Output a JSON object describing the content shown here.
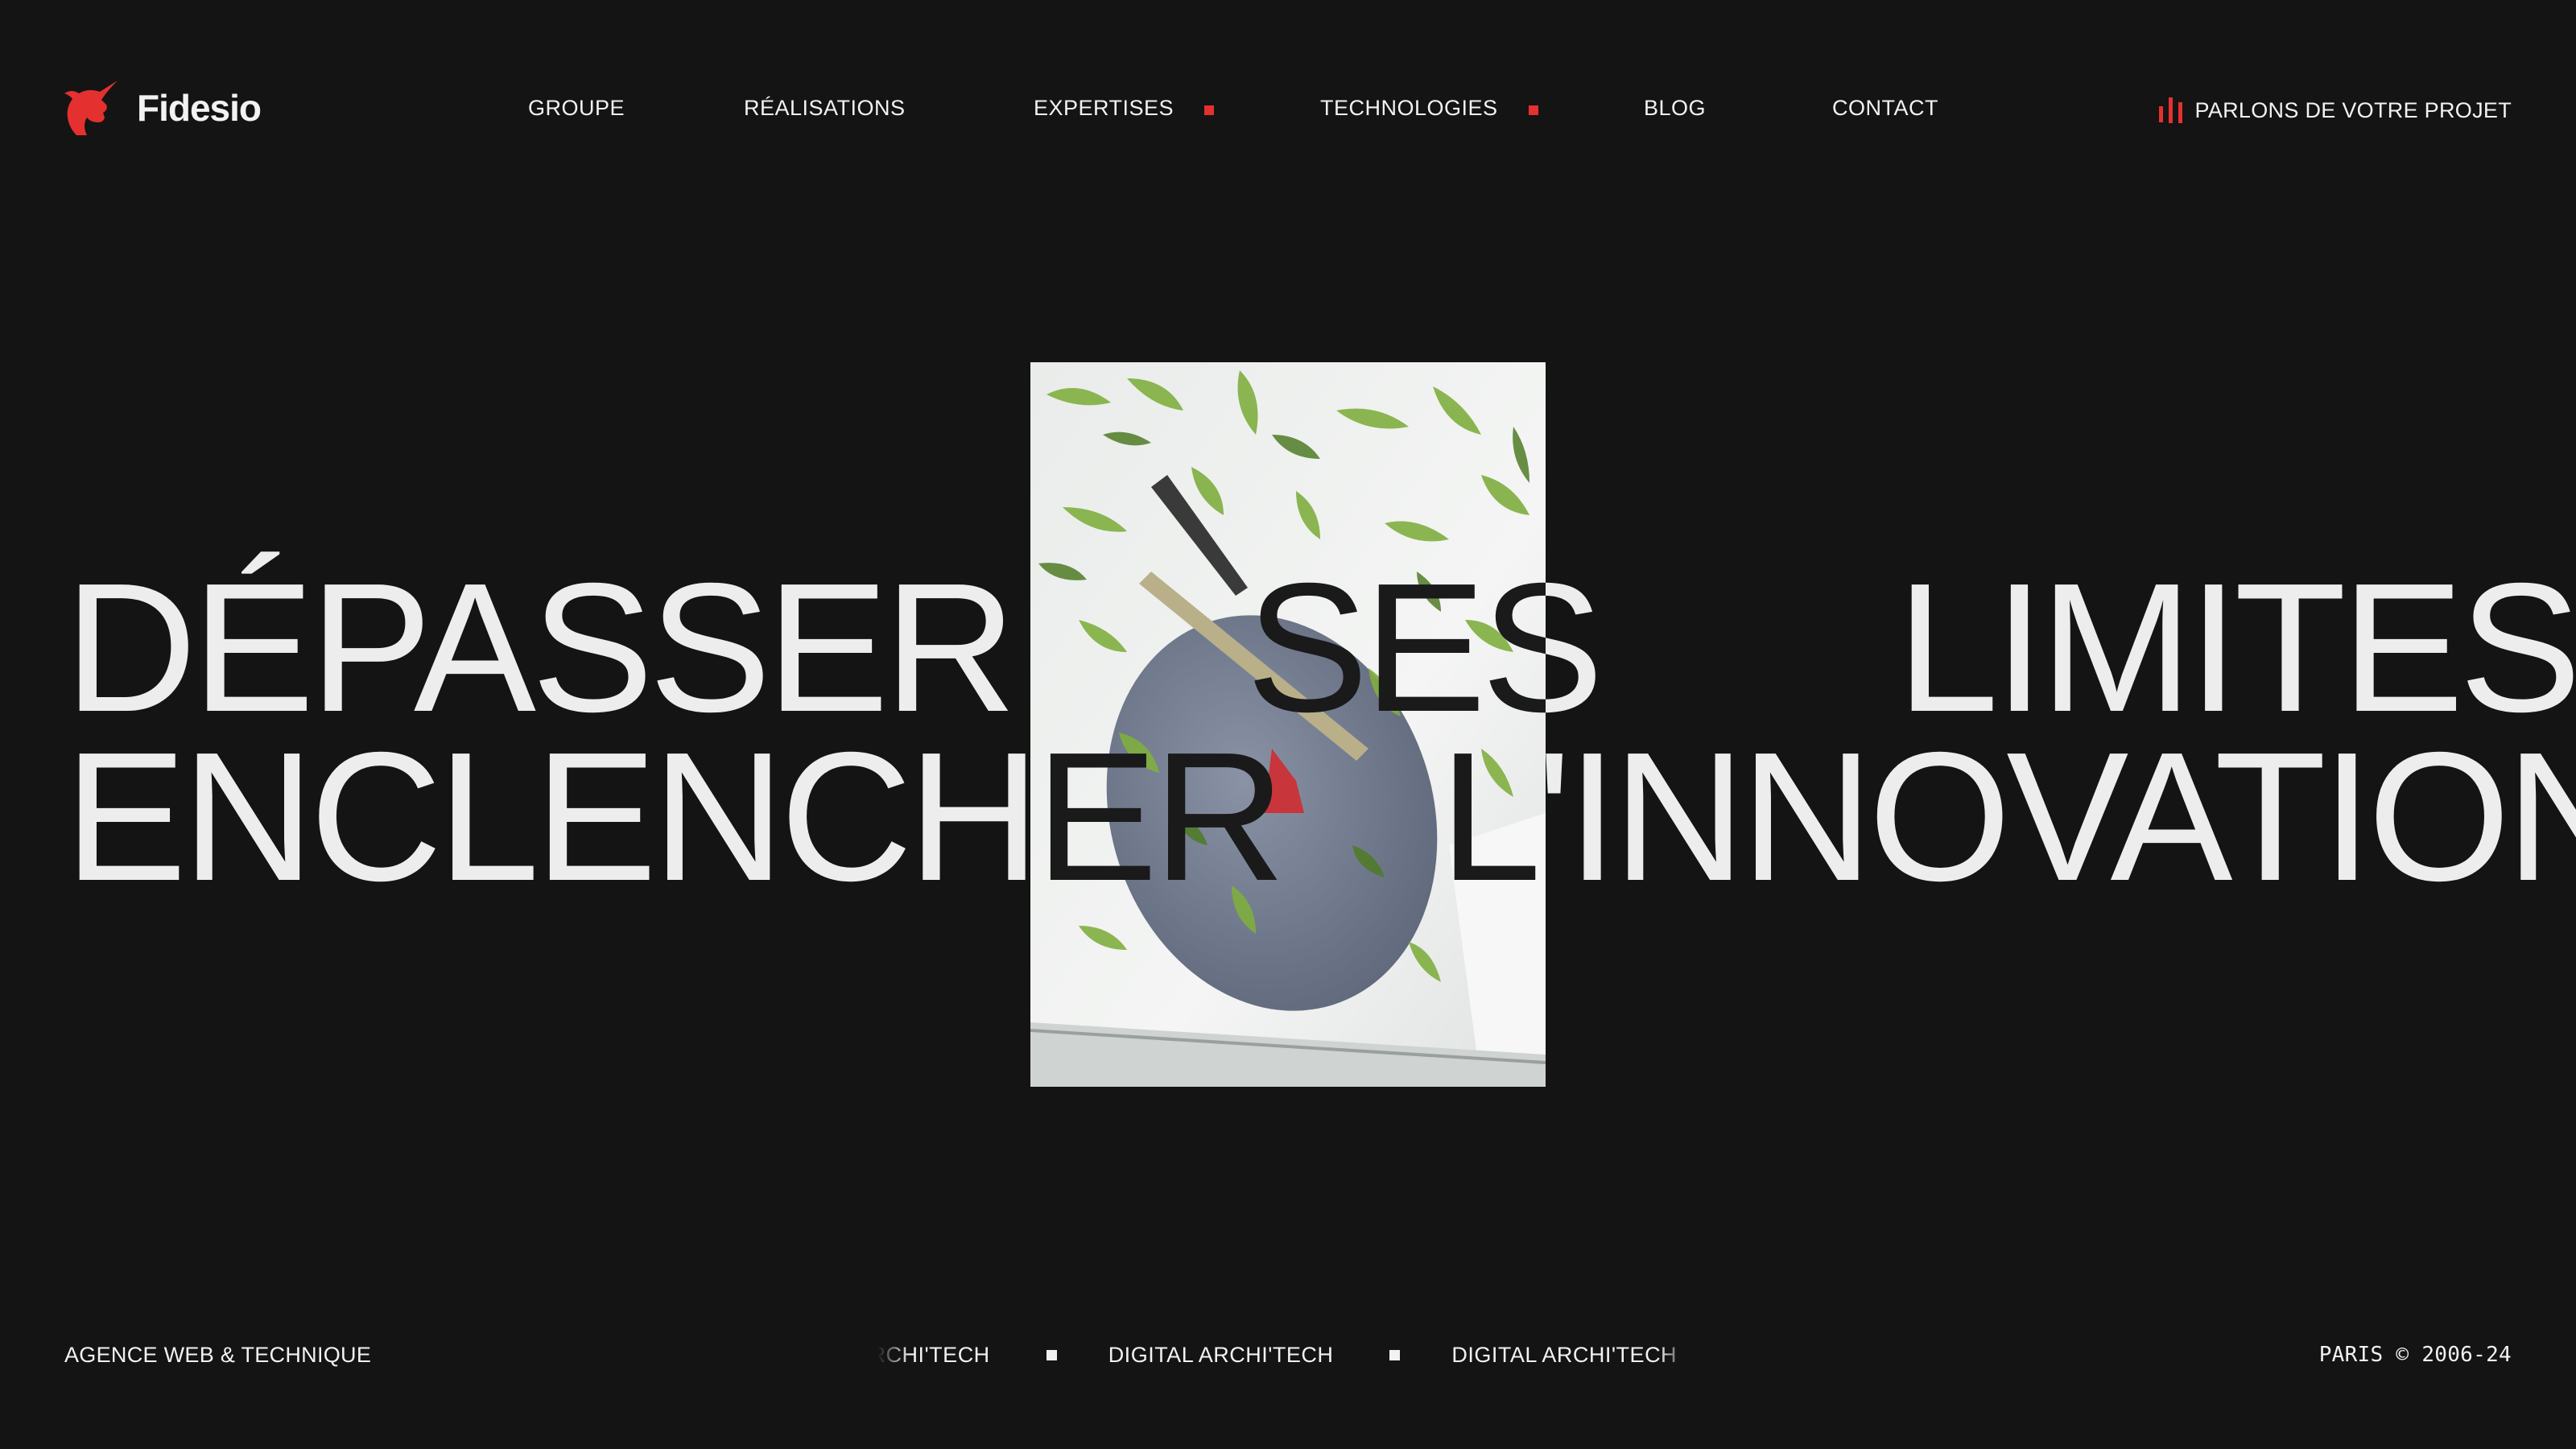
{
  "brand": {
    "name": "Fidesio",
    "logo_icon": "unicorn-head-icon",
    "accent_color": "#e53030",
    "background_color": "#141414",
    "text_color": "#f2f2f2"
  },
  "nav": {
    "items": [
      {
        "label": "GROUPE",
        "has_dropdown": false
      },
      {
        "label": "RÉALISATIONS",
        "has_dropdown": false
      },
      {
        "label": "EXPERTISES",
        "has_dropdown": true
      },
      {
        "label": "TECHNOLOGIES",
        "has_dropdown": true
      },
      {
        "label": "BLOG",
        "has_dropdown": false
      },
      {
        "label": "CONTACT",
        "has_dropdown": false
      }
    ],
    "cta_label": "PARLONS DE VOTRE PROJET",
    "cta_icon": "sound-bars-icon"
  },
  "hero": {
    "line1": {
      "left": "DÉPASSER",
      "middle": "SES",
      "right": "LIMITES"
    },
    "line2": {
      "left": "ENCLENCHER",
      "right": "L'INNOVATION"
    },
    "photo_description_icon": "office-sign-photo"
  },
  "footer": {
    "left": "AGENCE WEB & TECHNIQUE",
    "marquee": [
      "DIGITAL ARCHI'TECH",
      "DIGITAL ARCHI'TECH",
      "DIGITAL ARCHI'TECH"
    ],
    "right": "PARIS © 2006-24"
  }
}
